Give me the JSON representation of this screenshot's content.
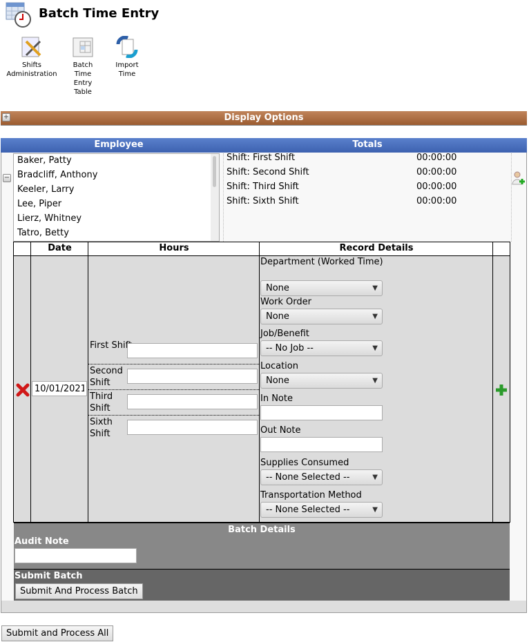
{
  "header": {
    "title": "Batch Time Entry"
  },
  "toolbar": [
    {
      "label": "Shifts Administration",
      "icon": "shifts-admin-icon"
    },
    {
      "label": "Batch Time Entry Table",
      "icon": "table-icon"
    },
    {
      "label": "Import Time",
      "icon": "import-icon"
    }
  ],
  "display_options": {
    "label": "Display Options"
  },
  "columns": {
    "employee": "Employee",
    "totals": "Totals"
  },
  "employees": [
    "Baker, Patty",
    "Bradcliff, Anthony",
    "Keeler, Larry",
    "Lee, Piper",
    "Lierz, Whitney",
    "Tatro, Betty"
  ],
  "totals": [
    {
      "label": "Shift: First Shift",
      "value": "00:00:00"
    },
    {
      "label": "Shift: Second Shift",
      "value": "00:00:00"
    },
    {
      "label": "Shift: Third Shift",
      "value": "00:00:00"
    },
    {
      "label": "Shift: Sixth Shift",
      "value": "00:00:00"
    }
  ],
  "entry_table": {
    "headers": {
      "date": "Date",
      "hours": "Hours",
      "details": "Record Details"
    },
    "date": "10/01/2021",
    "shifts": [
      "First Shift",
      "Second Shift",
      "Third Shift",
      "Sixth Shift"
    ],
    "details": {
      "department_label": "Department  (Worked  Time)",
      "department": "None",
      "work_order_label": "Work  Order",
      "work_order": "None",
      "job_label": "Job/Benefit",
      "job": "-- No Job --",
      "location_label": "Location",
      "location": "None",
      "in_note_label": "In  Note",
      "out_note_label": "Out  Note",
      "supplies_label": "Supplies  Consumed",
      "supplies": "-- None Selected --",
      "transport_label": "Transportation  Method",
      "transport": "-- None Selected --"
    }
  },
  "batch_details": {
    "title": "Batch Details",
    "audit_note_label": "Audit  Note"
  },
  "submit_batch": {
    "title": "Submit Batch",
    "button": "Submit And Process Batch"
  },
  "submit_all": "Submit and Process All"
}
